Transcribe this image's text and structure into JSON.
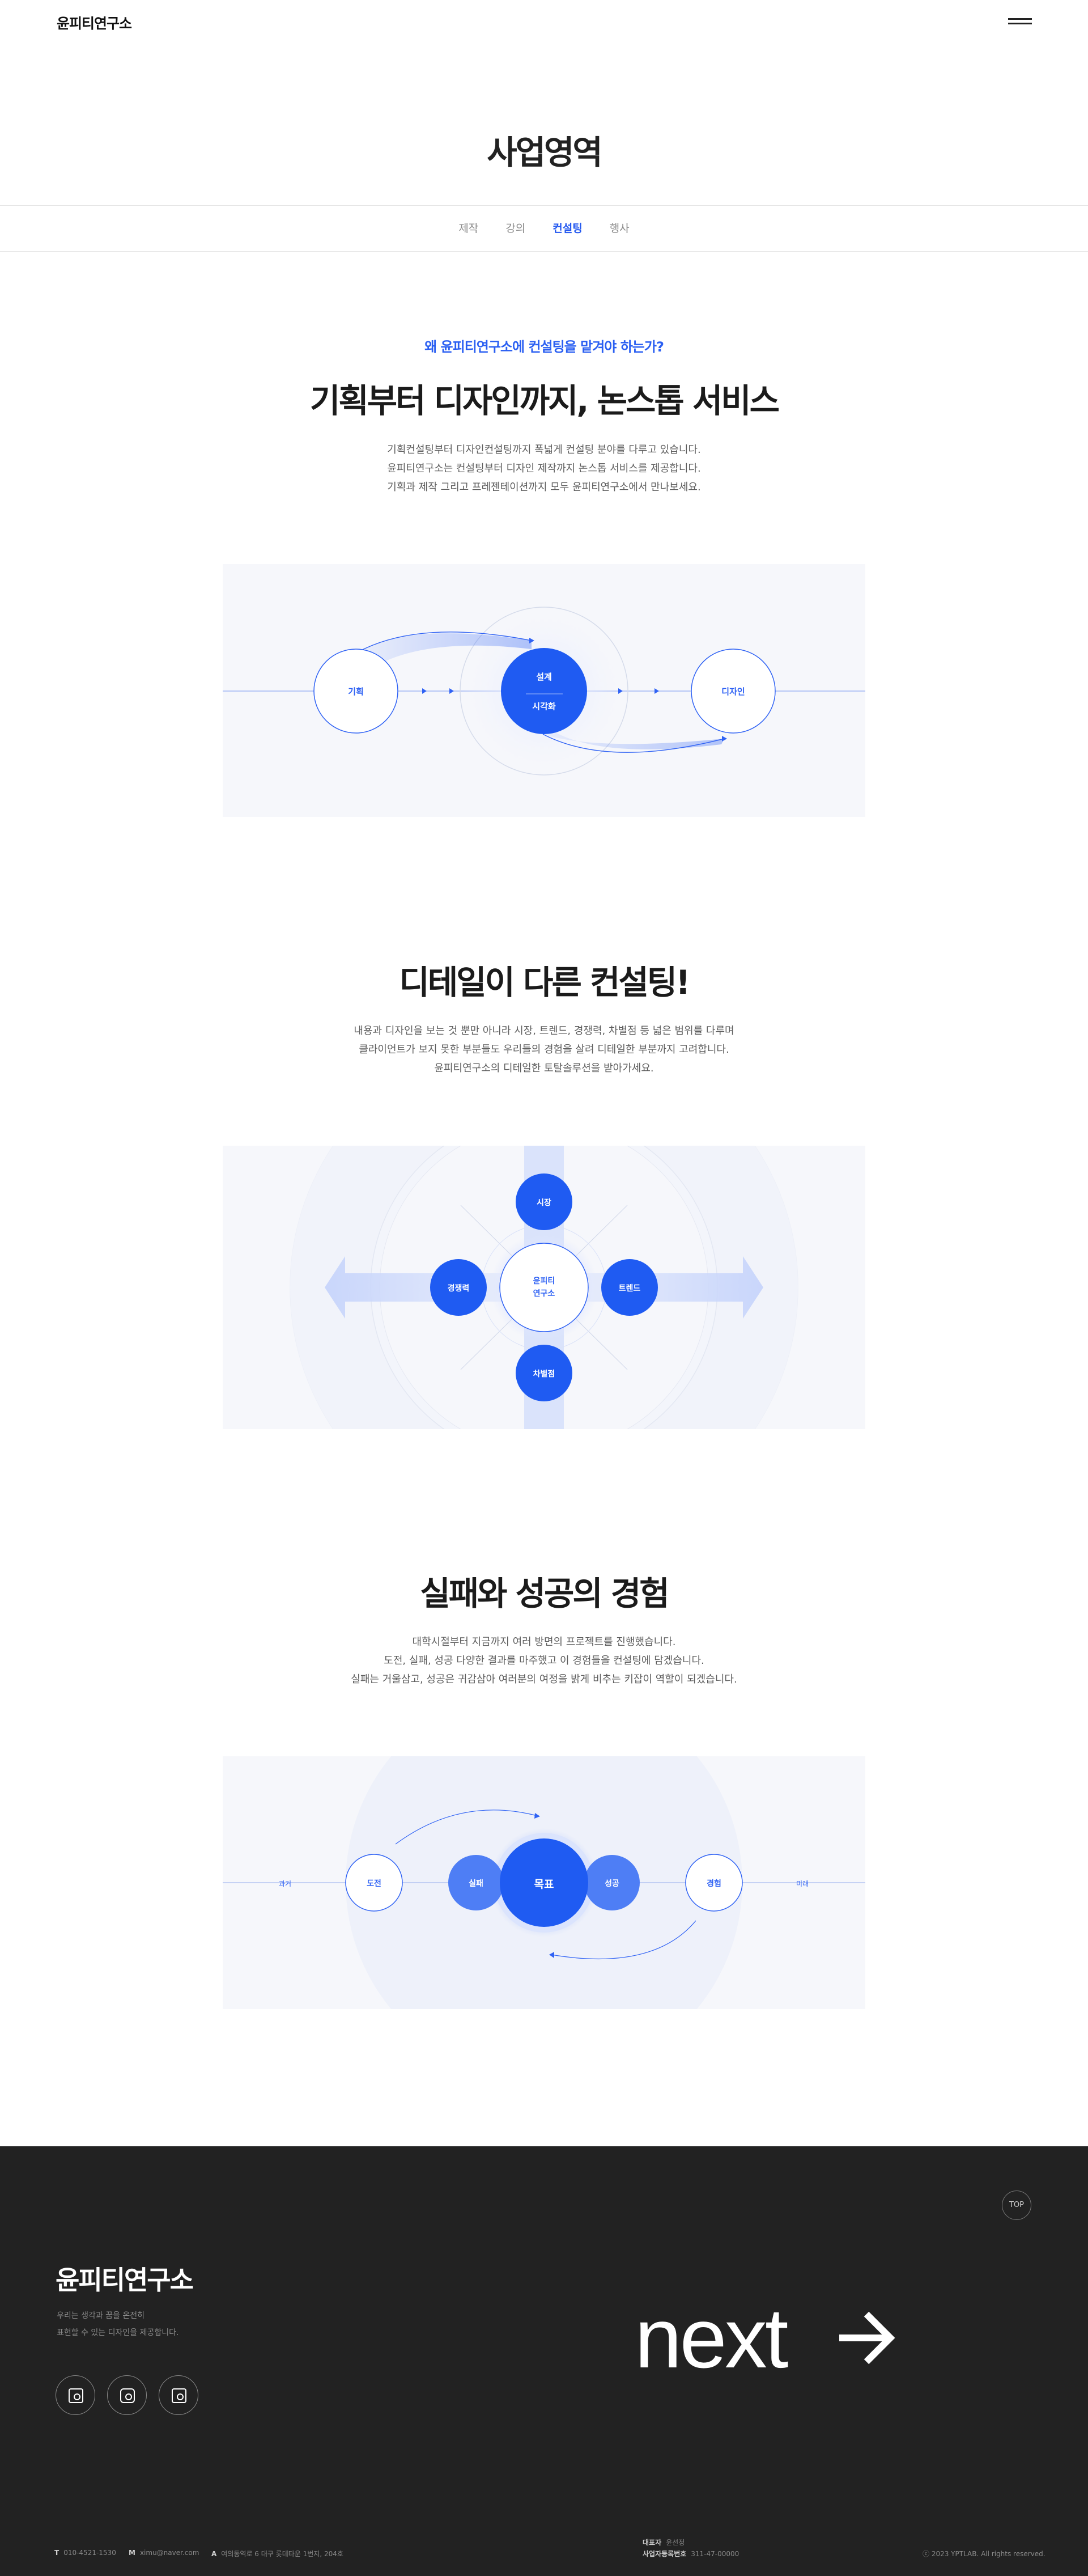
{
  "header": {
    "logo": "윤피티연구소",
    "menu_icon": "hamburger-icon"
  },
  "page_title": "사업영역",
  "tabs": [
    {
      "label": "제작",
      "active": false
    },
    {
      "label": "강의",
      "active": false
    },
    {
      "label": "컨설팅",
      "active": true
    },
    {
      "label": "행사",
      "active": false
    }
  ],
  "section1": {
    "eyebrow": "왜 윤피티연구소에 컨설팅을 맡겨야 하는가?",
    "title": "기획부터 디자인까지, 논스톱 서비스",
    "desc": [
      "기획컨설팅부터 디자인컨설팅까지 폭넓게 컨설팅 분야를 다루고 있습니다.",
      "윤피티연구소는 컨설팅부터 디자인 제작까지 논스톱 서비스를 제공합니다.",
      "기획과 제작 그리고 프레젠테이션까지 모두 윤피티연구소에서 만나보세요."
    ],
    "diagram": {
      "start": "기획",
      "center_top": "설계",
      "center_bottom": "시각화",
      "end": "디자인"
    }
  },
  "section2": {
    "title": "디테일이 다른 컨설팅!",
    "desc": [
      "내용과 디자인을 보는 것 뿐만 아니라 시장, 트렌드, 경쟁력, 차별점 등 넓은 범위를 다루며",
      "클라이언트가 보지 못한 부분들도 우리들의 경험을 살려 디테일한 부분까지 고려합니다.",
      "윤피티연구소의 디테일한 토탈솔루션을 받아가세요."
    ],
    "diagram": {
      "center_line1": "윤피티",
      "center_line2": "연구소",
      "top": "시장",
      "left": "경쟁력",
      "right": "트렌드",
      "bottom": "차별점"
    }
  },
  "section3": {
    "title": "실패와 성공의 경험",
    "desc": [
      "대학시절부터 지금까지 여러 방면의 프로젝트를 진행했습니다.",
      "도전, 실패, 성공 다양한 결과를 마주했고 이 경험들을 컨설팅에 담겠습니다.",
      "실패는 거울삼고, 성공은 귀감삼아 여러분의 여정을 밝게 비추는 키잡이 역할이 되겠습니다."
    ],
    "diagram": {
      "past": "과거",
      "challenge": "도전",
      "fail": "실패",
      "goal": "목표",
      "success": "성공",
      "experience": "경험",
      "future": "미래"
    }
  },
  "footer": {
    "top_label": "TOP",
    "logo": "윤피티연구소",
    "desc": [
      "우리는 생각과 꿈을 온전히",
      "표현할 수 있는 디자인을 제공합니다."
    ],
    "sns": [
      "blog-icon",
      "instagram-icon",
      "kakao-icon"
    ],
    "next_label": "next",
    "contact": [
      {
        "key": "T",
        "value": "010-4521-1530"
      },
      {
        "key": "M",
        "value": "ximu@naver.com"
      },
      {
        "key": "A",
        "value": "여의동역로 6 대구 롯데타운 1번지, 204호"
      }
    ],
    "ceo": {
      "key": "대표자",
      "value": "윤선정"
    },
    "biz": {
      "key": "사업자등록번호",
      "value": "311-47-00000"
    },
    "copyright": "ⓒ 2023 YPTLAB. All rights reserved."
  },
  "colors": {
    "accent": "#2358f0",
    "footer_bg": "#222222",
    "box_bg": "#f6f7fb"
  }
}
